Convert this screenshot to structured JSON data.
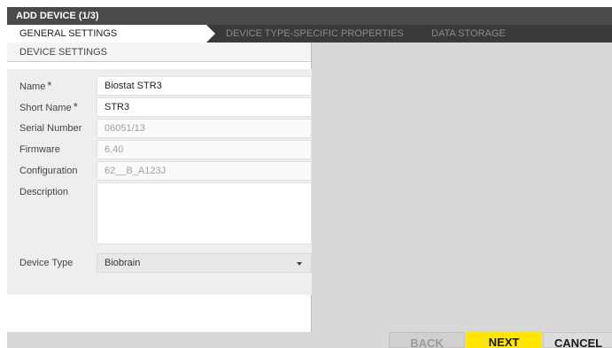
{
  "window": {
    "title": "ADD DEVICE (1/3)"
  },
  "tabs": [
    {
      "label": "GENERAL SETTINGS",
      "active": true
    },
    {
      "label": "DEVICE TYPE-SPECIFIC PROPERTIES",
      "active": false
    },
    {
      "label": "DATA STORAGE",
      "active": false
    }
  ],
  "section": {
    "title": "DEVICE SETTINGS"
  },
  "form": {
    "name": {
      "label": "Name",
      "value": "Biostat STR3",
      "required_mark": "*"
    },
    "short_name": {
      "label": "Short Name",
      "value": "STR3",
      "required_mark": "*"
    },
    "serial_number": {
      "label": "Serial Number",
      "value": "06051/13"
    },
    "firmware": {
      "label": "Firmware",
      "value": "6.40"
    },
    "configuration": {
      "label": "Configuration",
      "value": "62__B_A123J"
    },
    "description": {
      "label": "Description",
      "value": ""
    },
    "device_type": {
      "label": "Device Type",
      "value": "Biobrain"
    }
  },
  "buttons": {
    "back": "BACK",
    "next": "NEXT",
    "cancel": "CANCEL"
  },
  "colors": {
    "accent": "#ffe600",
    "titlebar": "#4a4a4a",
    "tabbar": "#3a3a3a"
  }
}
